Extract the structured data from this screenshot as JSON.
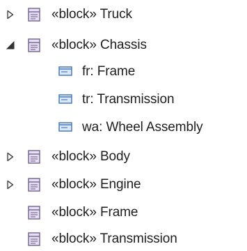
{
  "tree": {
    "items": [
      {
        "name": "tree-item-truck",
        "stereotype": "«block»",
        "title": "Truck",
        "kind": "block",
        "expander": "collapsed",
        "label_text": "«block» Truck"
      },
      {
        "name": "tree-item-chassis",
        "stereotype": "«block»",
        "title": "Chassis",
        "kind": "block",
        "expander": "expanded",
        "label_text": "«block» Chassis"
      },
      {
        "name": "tree-item-fr-frame",
        "stereotype": "",
        "title": "fr: Frame",
        "kind": "part",
        "expander": "none",
        "label_text": "fr: Frame"
      },
      {
        "name": "tree-item-tr-transmission",
        "stereotype": "",
        "title": "tr: Transmission",
        "kind": "part",
        "expander": "none",
        "label_text": "tr: Transmission"
      },
      {
        "name": "tree-item-wa-wheel-assembly",
        "stereotype": "",
        "title": "wa: Wheel Assembly",
        "kind": "part",
        "expander": "none",
        "label_text": "wa: Wheel Assembly"
      },
      {
        "name": "tree-item-body",
        "stereotype": "«block»",
        "title": "Body",
        "kind": "block",
        "expander": "collapsed",
        "label_text": "«block» Body"
      },
      {
        "name": "tree-item-engine",
        "stereotype": "«block»",
        "title": "Engine",
        "kind": "block",
        "expander": "collapsed",
        "label_text": "«block» Engine"
      },
      {
        "name": "tree-item-frame",
        "stereotype": "«block»",
        "title": "Frame",
        "kind": "block",
        "expander": "none",
        "label_text": "«block» Frame"
      },
      {
        "name": "tree-item-transmission",
        "stereotype": "«block»",
        "title": "Transmission",
        "kind": "block",
        "expander": "none",
        "label_text": "«block» Transmission"
      }
    ]
  },
  "icons": {
    "block": "block-element-icon",
    "part": "part-property-icon",
    "collapsed": "expand-arrow-icon",
    "expanded": "collapse-arrow-icon"
  },
  "colors": {
    "block_icon_border": "#7b6a9e",
    "block_icon_fill": "#e6e0f0",
    "part_icon_border": "#4a7bbf",
    "part_icon_fill": "#dbe8f7",
    "text": "#1e1e1e",
    "arrow": "#444444"
  }
}
